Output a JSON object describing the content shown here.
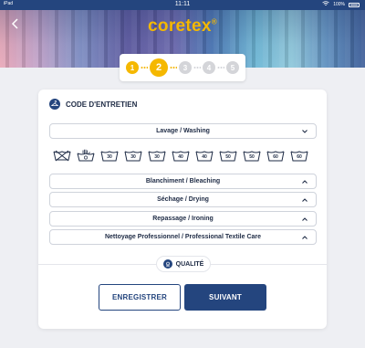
{
  "status_bar": {
    "carrier": "iPad",
    "time": "11:11",
    "battery": "100%"
  },
  "header": {
    "logo_text": "coretex",
    "logo_mark": "®",
    "back_icon": "chevron-left-icon"
  },
  "stepper": {
    "current_step": 2,
    "steps": [
      {
        "label": "1",
        "state": "done"
      },
      {
        "label": "2",
        "state": "active"
      },
      {
        "label": "3",
        "state": "todo"
      },
      {
        "label": "4",
        "state": "todo"
      },
      {
        "label": "5",
        "state": "todo"
      }
    ]
  },
  "care_section": {
    "title": "CODE D'ENTRETIEN",
    "icon": "hanger-icon",
    "washing_label": "Lavage / Washing",
    "washing_symbols": [
      "",
      "",
      "30",
      "30",
      "30",
      "40",
      "40",
      "50",
      "50",
      "60",
      "60"
    ],
    "accordions": [
      {
        "label": "Blanchiment / Bleaching"
      },
      {
        "label": "Séchage / Drying"
      },
      {
        "label": "Repassage / Ironing"
      },
      {
        "label": "Nettoyage Professionnel / Professional Textile Care"
      }
    ]
  },
  "quality_section": {
    "title": "QUALITÉ",
    "icon": "quality-icon"
  },
  "actions": {
    "save_label": "ENREGISTRER",
    "next_label": "SUIVANT"
  },
  "colors": {
    "primary": "#24457e",
    "accent": "#f5b800",
    "background": "#eeeff3"
  }
}
